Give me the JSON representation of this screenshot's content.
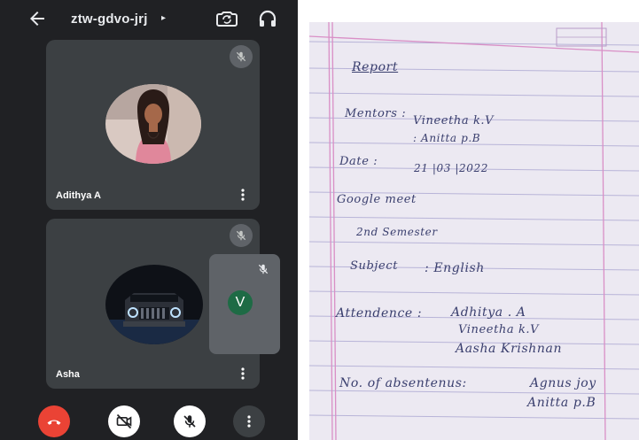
{
  "call": {
    "meeting_code": "ztw-gdvo-jrj",
    "caret": "▸",
    "participants": [
      {
        "name": "Adithya A",
        "muted": true
      },
      {
        "name": "Asha",
        "muted": true
      }
    ],
    "self_tile": {
      "initial": "V",
      "muted": true
    }
  },
  "colors": {
    "background": "#202124",
    "tile": "#3c4043",
    "end_call": "#ea4335",
    "self_avatar": "#1e6b45",
    "ink": "#3a3f6e",
    "margin_line": "#d98fc6"
  },
  "icons": {
    "back": "arrow-left-icon",
    "switch_camera": "switch-camera-icon",
    "audio_output": "headphones-icon",
    "mic_off": "mic-off-icon",
    "more": "more-vertical-icon",
    "end_call": "phone-hangup-icon",
    "camera_off": "camera-off-icon"
  },
  "notebook": {
    "report": "Report",
    "mentors_label": "Mentors :",
    "mentor_1": "Vineetha k.V",
    "mentor_2": ": Anitta p.B",
    "date_label": "Date :",
    "date_value": "21 |03 |2022",
    "google_meet": "Google meet",
    "semester": "2nd Semester",
    "subject_label": "Subject",
    "subject_value": ": English",
    "attendance_label": "Attendence :",
    "attendee_1": "Adhitya . A",
    "attendee_2": "Vineetha k.V",
    "attendee_3": "Aasha Krishnan",
    "absentees_label": "No. of absentenus:",
    "absentee_1": "Agnus joy",
    "absentee_2": "Anitta p.B"
  }
}
